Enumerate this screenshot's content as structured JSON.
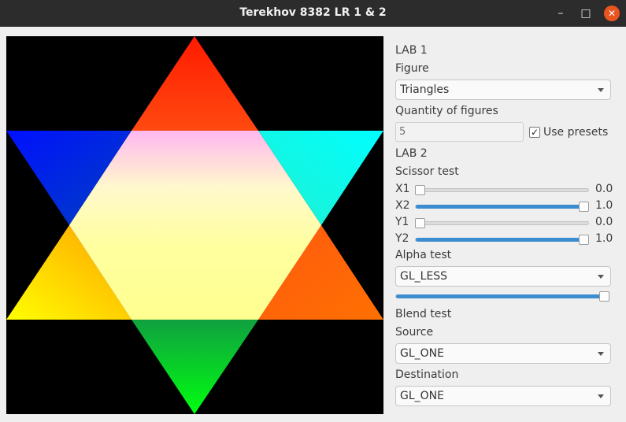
{
  "window": {
    "title": "Terekhov 8382 LR 1 & 2",
    "minimize_glyph": "–",
    "maximize_glyph": "□",
    "close_glyph": "✕"
  },
  "icons": [
    "minimize-icon",
    "maximize-icon",
    "close-icon",
    "chevron-down-icon",
    "check-icon"
  ],
  "colors": {
    "accent": "#3c8cd0",
    "close_button": "#e9541f",
    "titlebar": "#2c2c2c",
    "canvas_bg": "#000000"
  },
  "canvas": {
    "figure": "hexagram",
    "corner_colors": {
      "top": "#ff1a00",
      "upper_left": "#0010ff",
      "upper_right": "#00ffff",
      "lower_left": "#ffff00",
      "lower_right": "#ff7000",
      "bottom": "#00ff10",
      "center": "#fffeb0"
    }
  },
  "lab1": {
    "heading": "LAB 1",
    "figure_label": "Figure",
    "figure_value": "Triangles",
    "quantity_label": "Quantity of figures",
    "quantity_placeholder": "5",
    "use_presets_label": "Use presets",
    "use_presets_checked": true,
    "check_glyph": "✓"
  },
  "lab2": {
    "heading": "LAB 2",
    "scissor_label": "Scissor test",
    "sliders": [
      {
        "label": "X1",
        "value_text": "0.0",
        "value": 0.0
      },
      {
        "label": "X2",
        "value_text": "1.0",
        "value": 1.0
      },
      {
        "label": "Y1",
        "value_text": "0.0",
        "value": 0.0
      },
      {
        "label": "Y2",
        "value_text": "1.0",
        "value": 1.0
      }
    ],
    "alpha_label": "Alpha test",
    "alpha_func": "GL_LESS",
    "alpha_ref": 1.0,
    "blend_label": "Blend test",
    "source_label": "Source",
    "source_value": "GL_ONE",
    "destination_label": "Destination",
    "destination_value": "GL_ONE"
  }
}
